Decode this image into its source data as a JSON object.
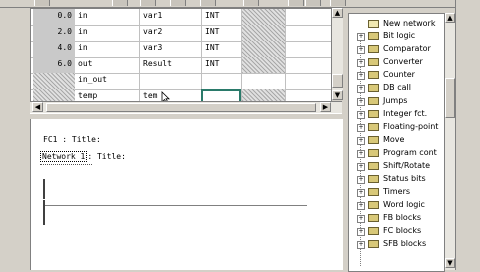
{
  "declaration_table": {
    "rows": [
      {
        "address": "0.0",
        "decl": "in",
        "name": "var1",
        "type": "INT"
      },
      {
        "address": "2.0",
        "decl": "in",
        "name": "var2",
        "type": "INT"
      },
      {
        "address": "4.0",
        "decl": "in",
        "name": "var3",
        "type": "INT"
      },
      {
        "address": "6.0",
        "decl": "out",
        "name": "Result",
        "type": "INT"
      },
      {
        "address": "",
        "decl": "in_out",
        "name": "",
        "type": ""
      },
      {
        "address": "",
        "decl": "temp",
        "name": "tem",
        "type": ""
      }
    ]
  },
  "code": {
    "block_title": "FC1 : Title:",
    "network_label": "Network 1",
    "network_title_suffix": ": Title:"
  },
  "tree": {
    "items": [
      {
        "label": "New network",
        "icon": "new-network-icon",
        "expand": false
      },
      {
        "label": "Bit logic",
        "icon": "folder-icon",
        "expand": true
      },
      {
        "label": "Comparator",
        "icon": "folder-icon",
        "expand": true
      },
      {
        "label": "Converter",
        "icon": "folder-icon",
        "expand": true
      },
      {
        "label": "Counter",
        "icon": "folder-icon",
        "expand": true
      },
      {
        "label": "DB call",
        "icon": "folder-icon",
        "expand": true
      },
      {
        "label": "Jumps",
        "icon": "folder-icon",
        "expand": true
      },
      {
        "label": "Integer fct.",
        "icon": "folder-icon",
        "expand": true
      },
      {
        "label": "Floating-point",
        "icon": "folder-icon",
        "expand": true
      },
      {
        "label": "Move",
        "icon": "folder-icon",
        "expand": true
      },
      {
        "label": "Program cont",
        "icon": "folder-icon",
        "expand": true
      },
      {
        "label": "Shift/Rotate",
        "icon": "folder-icon",
        "expand": true
      },
      {
        "label": "Status bits",
        "icon": "folder-icon",
        "expand": true
      },
      {
        "label": "Timers",
        "icon": "folder-icon",
        "expand": true
      },
      {
        "label": "Word logic",
        "icon": "folder-icon",
        "expand": true
      },
      {
        "label": "FB blocks",
        "icon": "folder-icon",
        "expand": true
      },
      {
        "label": "FC blocks",
        "icon": "folder-icon",
        "expand": true
      },
      {
        "label": "SFB blocks",
        "icon": "folder-icon",
        "expand": true
      }
    ]
  },
  "colors": {
    "window_bg": "#d4d0c8",
    "selection_outline": "#2a7a6a",
    "address_column": "#c9c9c9"
  }
}
